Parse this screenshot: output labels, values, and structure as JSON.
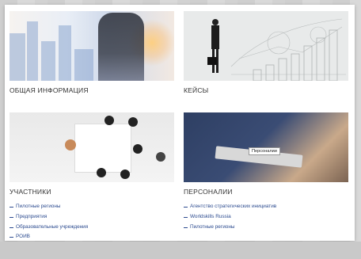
{
  "cards": [
    {
      "title": "ОБЩАЯ ИНФОРМАЦИЯ",
      "image": "city-businessman-image",
      "links": []
    },
    {
      "title": "КЕЙСЫ",
      "image": "growth-graph-image",
      "links": []
    },
    {
      "title": "УЧАСТНИКИ",
      "image": "meeting-image",
      "links": [
        "Пилотные регионы",
        "Предприятия",
        "Образовательные учреждения",
        "РОИВ"
      ]
    },
    {
      "title": "ПЕРСОНАЛИИ",
      "image": "tablet-handshake-image",
      "tooltip": "Персоналии",
      "links": [
        "Агентство стратегических инициатив",
        "Worldskills Russia",
        "Пилотные регионы"
      ]
    }
  ],
  "colors": {
    "link": "#2c4b8f",
    "title": "#333333",
    "page_background": "#d6d6d6"
  }
}
